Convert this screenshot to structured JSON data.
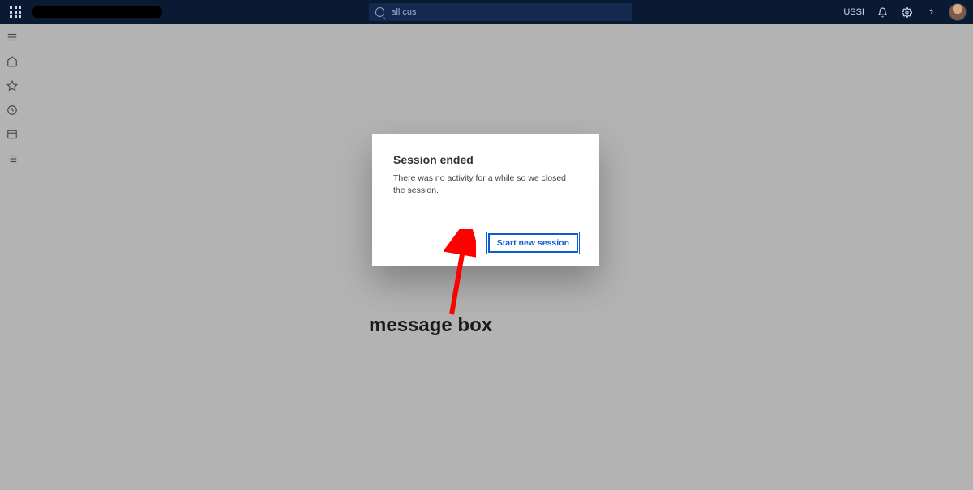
{
  "topbar": {
    "search_value": "all cus",
    "company_code": "USSI"
  },
  "sidebar": {
    "items": [
      {
        "name": "menu"
      },
      {
        "name": "home"
      },
      {
        "name": "favorites"
      },
      {
        "name": "recent"
      },
      {
        "name": "workspaces"
      },
      {
        "name": "modules"
      }
    ]
  },
  "dialog": {
    "title": "Session ended",
    "body": "There was no activity for a while so we closed the session.",
    "primary_button": "Start new session"
  },
  "annotation": {
    "label": "message box"
  }
}
